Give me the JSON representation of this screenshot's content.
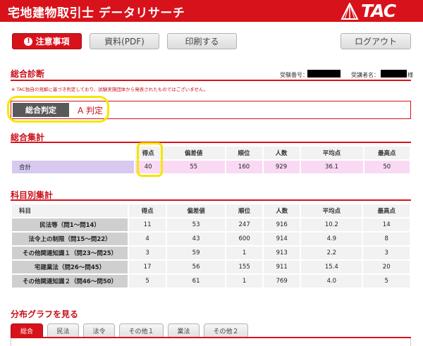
{
  "header": {
    "title": "宅地建物取引士 データリサーチ",
    "logo_text": "TAC"
  },
  "toolbar": {
    "notice": "注意事項",
    "pdf": "資料(PDF)",
    "print": "印刷する",
    "logout": "ログアウト"
  },
  "sogo_shindan": {
    "title": "総合診断",
    "exam_number_label": "受験番号：",
    "name_label": "受講者名：",
    "honorific": "様",
    "note": "※ TAC独自の見解に基づき判定しており、試験実施団体から発表されたものではございません。",
    "judge_label": "総合判定",
    "judge_value": "A 判定"
  },
  "sogo_shukei": {
    "title": "総合集計",
    "headers": [
      "得点",
      "偏差値",
      "順位",
      "人数",
      "平均点",
      "最高点"
    ],
    "row": {
      "label": "合計",
      "values": [
        "40",
        "55",
        "160",
        "929",
        "36.1",
        "50"
      ]
    }
  },
  "kamoku_shukei": {
    "title": "科目別集計",
    "headers": [
      "科目",
      "得点",
      "偏差値",
      "順位",
      "人数",
      "平均点",
      "最高点"
    ],
    "rows": [
      {
        "label": "民法等（問1〜問14）",
        "values": [
          "11",
          "53",
          "247",
          "916",
          "10.2",
          "14"
        ]
      },
      {
        "label": "法令上の制限（問15〜問22）",
        "values": [
          "4",
          "43",
          "600",
          "914",
          "4.9",
          "8"
        ]
      },
      {
        "label": "その他関連知識１（問23〜問25）",
        "values": [
          "3",
          "59",
          "1",
          "913",
          "2.2",
          "3"
        ]
      },
      {
        "label": "宅建業法（問26〜問45）",
        "values": [
          "17",
          "56",
          "155",
          "911",
          "15.4",
          "20"
        ]
      },
      {
        "label": "その他関連知識２（問46〜問50）",
        "values": [
          "5",
          "61",
          "1",
          "769",
          "4.0",
          "5"
        ]
      }
    ]
  },
  "bunpu": {
    "title": "分布グラフを見る",
    "tabs": [
      "総合",
      "民法",
      "法令",
      "その他１",
      "業法",
      "その他２"
    ]
  },
  "colors": {
    "brand_red": "#d8121b",
    "highlight_yellow": "#f5e600",
    "sum_label_bg": "#d7c9ef",
    "sum_value_bg": "#f9d9f3"
  }
}
